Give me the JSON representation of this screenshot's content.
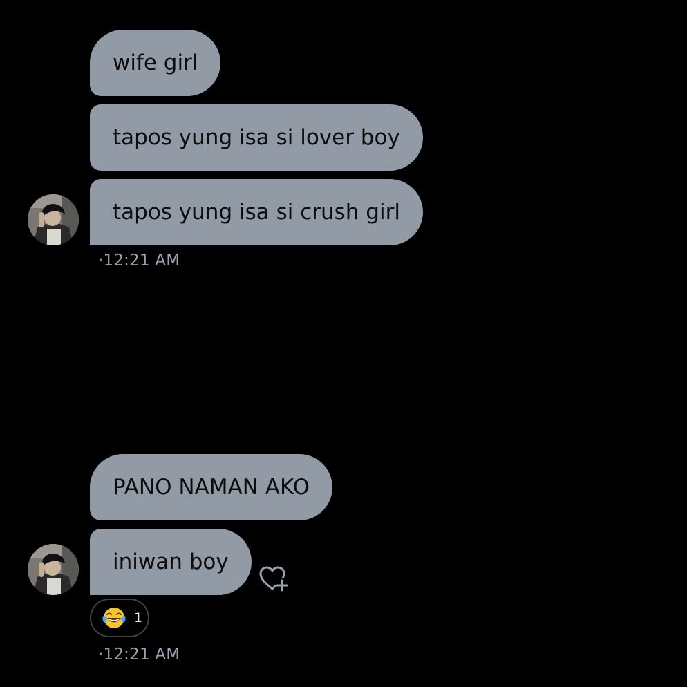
{
  "conversation": {
    "group1": {
      "messages": [
        {
          "text": "wife girl"
        },
        {
          "text": "tapos yung isa si lover boy"
        },
        {
          "text": "tapos yung isa si crush girl"
        }
      ],
      "timestamp": "·12:21 AM"
    },
    "group2": {
      "messages": [
        {
          "text": "PANO NAMAN AKO"
        },
        {
          "text": "iniwan boy"
        }
      ],
      "reaction": {
        "emoji": "face-with-tears-of-joy",
        "count": "1"
      },
      "timestamp": "·12:21 AM"
    }
  },
  "colors": {
    "background": "#000000",
    "bubble": "#919aa5",
    "bubble_text": "#0c0c0e",
    "timestamp": "#9aa2ad"
  }
}
